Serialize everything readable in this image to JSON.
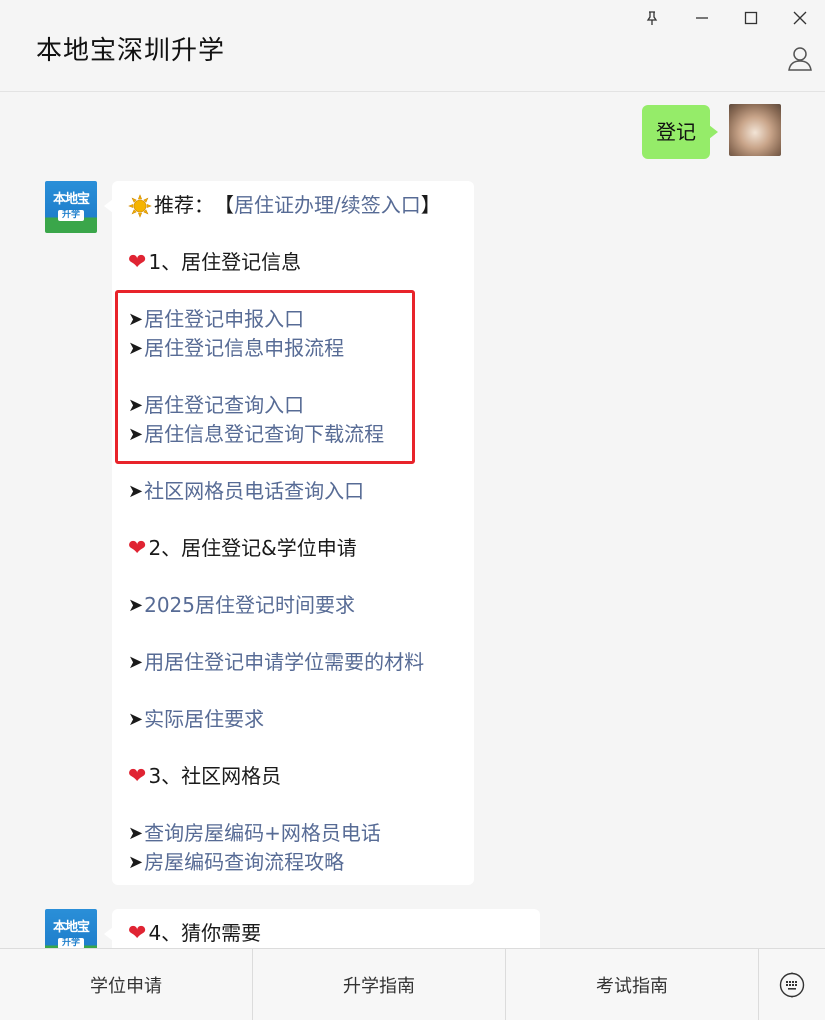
{
  "window": {
    "title": "本地宝深圳升学",
    "controls": [
      "pin-icon",
      "minimize-icon",
      "maximize-icon",
      "close-icon"
    ],
    "profile_icon": "person-icon"
  },
  "messages": {
    "sent": {
      "text": "登记"
    },
    "bot_avatar": {
      "logo_top": "本地宝",
      "logo_bottom": "升学"
    },
    "card1": {
      "recommend": {
        "icon": "sun-icon",
        "prefix": "推荐：",
        "bracket_open": "【",
        "link": "居住证办理/续签入口",
        "bracket_close": "】"
      },
      "section1": {
        "icon": "heart-icon",
        "text": "1、居住登记信息"
      },
      "links1": [
        "居住登记申报入口",
        "居住登记信息申报流程"
      ],
      "links2": [
        "居住登记查询入口",
        "居住信息登记查询下载流程"
      ],
      "link3": "社区网格员电话查询入口",
      "section2": {
        "icon": "heart-icon",
        "text": "2、居住登记&学位申请"
      },
      "link4": "2025居住登记时间要求",
      "link5": "用居住登记申请学位需要的材料",
      "link6": "实际居住要求",
      "section3": {
        "icon": "heart-icon",
        "text": "3、社区网格员"
      },
      "links7": [
        "查询房屋编码+网格员电话",
        "房屋编码查询流程攻略"
      ],
      "arrow": "➤"
    },
    "card2": {
      "section4": {
        "icon": "heart-icon",
        "text": "4、猜你需要"
      }
    }
  },
  "menu": {
    "items": [
      "学位申请",
      "升学指南",
      "考试指南"
    ],
    "keyboard_icon": "keyboard-icon"
  },
  "colors": {
    "link": "#576b95",
    "sent_bubble": "#95ec69",
    "highlight": "#e8232a",
    "heart": "#e02433"
  }
}
